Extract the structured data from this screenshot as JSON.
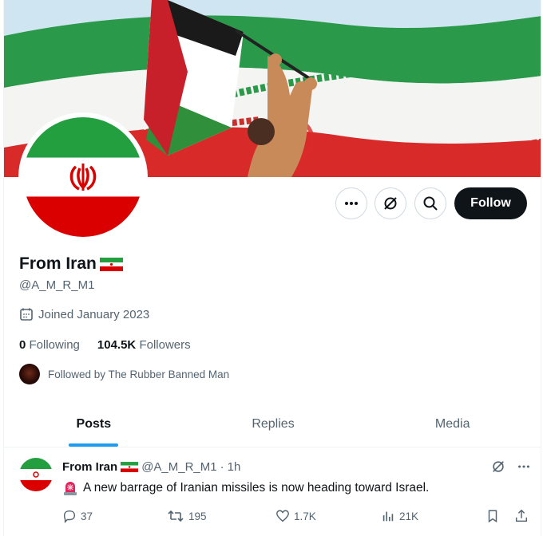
{
  "profile": {
    "display_name": "From Iran",
    "handle": "@A_M_R_M1",
    "joined": "Joined January 2023",
    "following_count": "0",
    "following_label": "Following",
    "followers_count": "104.5K",
    "followers_label": "Followers",
    "followed_by": "Followed by The Rubber Banned Man",
    "follow_label": "Follow"
  },
  "tabs": [
    {
      "label": "Posts",
      "active": true
    },
    {
      "label": "Replies",
      "active": false
    },
    {
      "label": "Media",
      "active": false
    }
  ],
  "tweet": {
    "name": "From Iran",
    "handle": "@A_M_R_M1",
    "separator": "·",
    "time": "1h",
    "text": "A new barrage of Iranian missiles is now heading toward Israel.",
    "replies": "37",
    "reposts": "195",
    "likes": "1.7K",
    "views": "21K"
  },
  "colors": {
    "accent": "#1d9bf0",
    "iran_green": "#239f40",
    "iran_red": "#da0000",
    "text_primary": "#0f1419",
    "text_secondary": "#536471"
  },
  "icons": [
    "more-icon",
    "grok-icon",
    "search-icon",
    "calendar-icon",
    "reply-icon",
    "repost-icon",
    "like-icon",
    "views-icon",
    "bookmark-icon",
    "share-icon",
    "siren-icon"
  ]
}
